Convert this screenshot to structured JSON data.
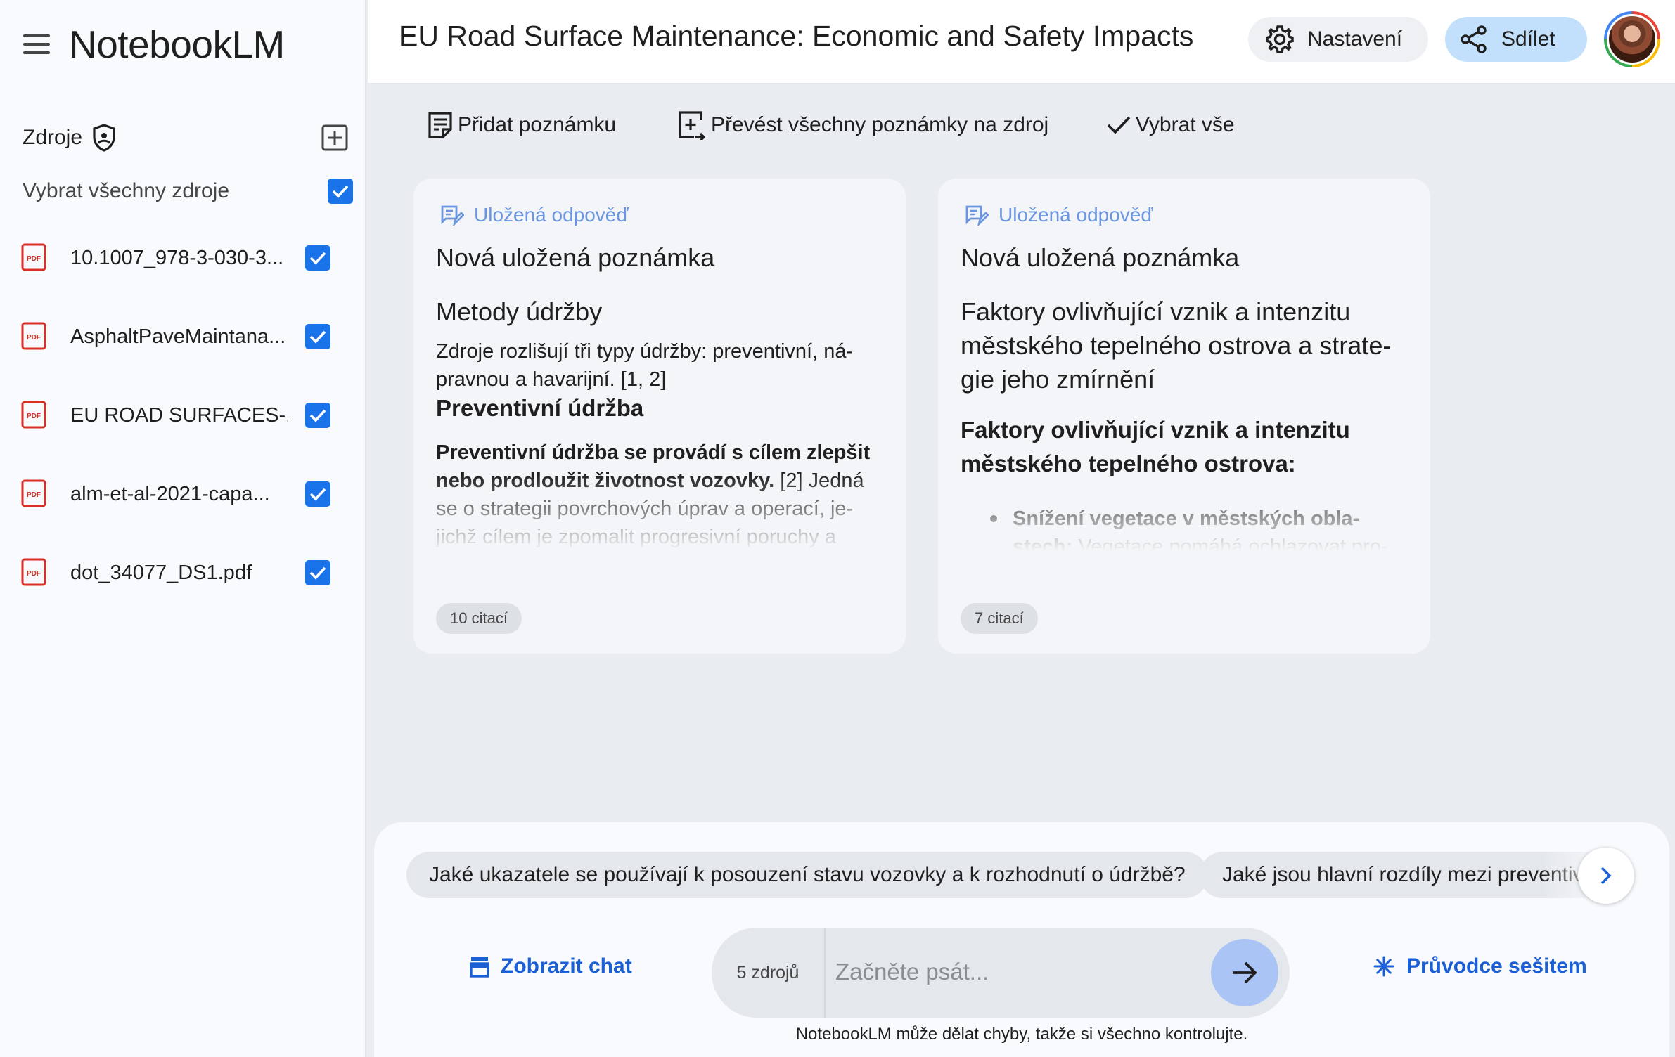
{
  "app": {
    "name": "NotebookLM"
  },
  "sidebar": {
    "sources_title": "Zdroje",
    "select_all_label": "Vybrat všechny zdroje",
    "select_all_checked": true,
    "sources": [
      {
        "name": "10.1007_978-3-030-3...",
        "type": "pdf",
        "checked": true
      },
      {
        "name": "AsphaltPaveMaintana...",
        "type": "pdf",
        "checked": true
      },
      {
        "name": "EU ROAD SURFACES-...",
        "type": "pdf",
        "checked": true
      },
      {
        "name": "alm-et-al-2021-capa...",
        "type": "pdf",
        "checked": true
      },
      {
        "name": "dot_34077_DS1.pdf",
        "type": "pdf",
        "checked": true
      }
    ]
  },
  "header": {
    "notebook_title": "EU Road Surface Maintenance: Economic and Safety Impacts",
    "settings_label": "Nastavení",
    "share_label": "Sdílet"
  },
  "toolbar": {
    "add_note": "Přidat poznámku",
    "convert_notes": "Převést všechny poznámky na zdroj",
    "select_all": "Vybrat vše"
  },
  "notes": [
    {
      "kind": "Uložená odpověď",
      "title": "Nová uložená poznámka",
      "heading": "Metody údržby",
      "intro": "Zdroje rozlišují tři typy údržby: preventivní, ná-pravnou a havarijní. [1, 2]",
      "subheading": "Preventivní údržba",
      "para_bold": "Preventivní údržba se provádí s cílem zlepšit nebo prodloužit životnost vozovky.",
      "para_rest": " [2] Jedná se o strategii povrchových úprav a operací, je-jichž cílem je zpomalit progresivní poruchy a",
      "citations": "10 citací"
    },
    {
      "kind": "Uložená odpověď",
      "title": "Nová uložená poznámka",
      "heading": "Faktory ovlivňující vznik a intenzitu městského tepelného ostrova a strate-gie jeho zmírnění",
      "subheading": "Faktory ovlivňující vznik a intenzitu městského tepelného ostrova:",
      "bullet_bold": "Snížení vegetace v městských obla-stech:",
      "bullet_rest": " Vegetace pomáhá ochlazovat pro-středí evapotranspirací. Snížení vegetace",
      "citations": "7 citací"
    }
  ],
  "chat": {
    "suggestions": [
      "Jaké ukazatele se používají k posouzení stavu vozovky a k rozhodnutí o údržbě?",
      "Jaké jsou hlavní rozdíly mezi preventivní"
    ],
    "show_chat": "Zobrazit chat",
    "source_count": "5 zdrojů",
    "placeholder": "Začněte psát...",
    "notebook_guide": "Průvodce sešitem",
    "disclaimer": "NotebookLM může dělat chyby, takže si všechno kontrolujte."
  },
  "colors": {
    "accent": "#1a73e8",
    "share_bg": "#c2e0fc",
    "link": "#1a5fd6",
    "pdf_red": "#d93025",
    "note_kind": "#6a95e0"
  }
}
